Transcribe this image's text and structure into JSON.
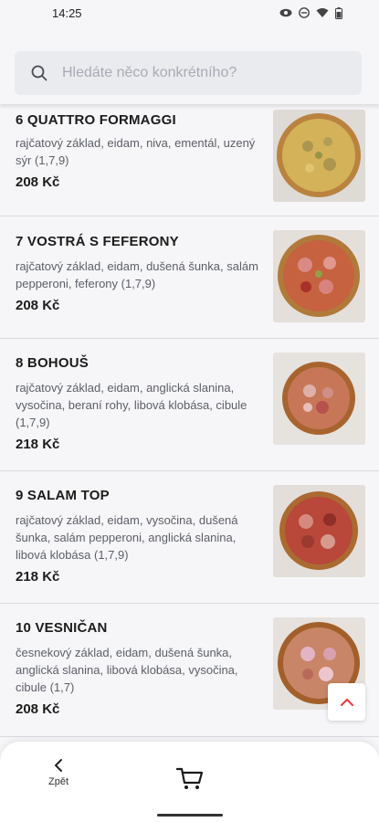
{
  "status_bar": {
    "time": "14:25"
  },
  "search": {
    "placeholder": "Hledáte něco konkrétního?"
  },
  "items": [
    {
      "name": "6 QUATTRO FORMAGGI",
      "description": "rajčatový základ, eidam, niva, ementál, uzený sýr (1,7,9)",
      "price": "208 Kč"
    },
    {
      "name": "7 VOSTRÁ S FEFERONY",
      "description": "rajčatový základ, eidam, dušená šunka, salám pepperoni, feferony (1,7,9)",
      "price": "208 Kč"
    },
    {
      "name": "8 BOHOUŠ",
      "description": "rajčatový základ, eidam, anglická slanina, vysočina, beraní rohy, libová klobása, cibule (1,7,9)",
      "price": "218 Kč"
    },
    {
      "name": "9 SALAM TOP",
      "description": "rajčatový základ, eidam, vysočina, dušená šunka, salám pepperoni, anglická slanina, libová klobása (1,7,9)",
      "price": "218 Kč"
    },
    {
      "name": "10 VESNIČAN",
      "description": "česnekový základ, eidam, dušená šunka, anglická slanina, libová klobása, vysočina, cibule (1,7)",
      "price": "208 Kč"
    }
  ],
  "bottom_bar": {
    "back_label": "Zpět"
  },
  "icons": {
    "search": "search-icon",
    "back": "chevron-left-icon",
    "cart": "cart-icon",
    "scroll_top": "chevron-up-icon"
  },
  "colors": {
    "accent": "#e53935"
  }
}
